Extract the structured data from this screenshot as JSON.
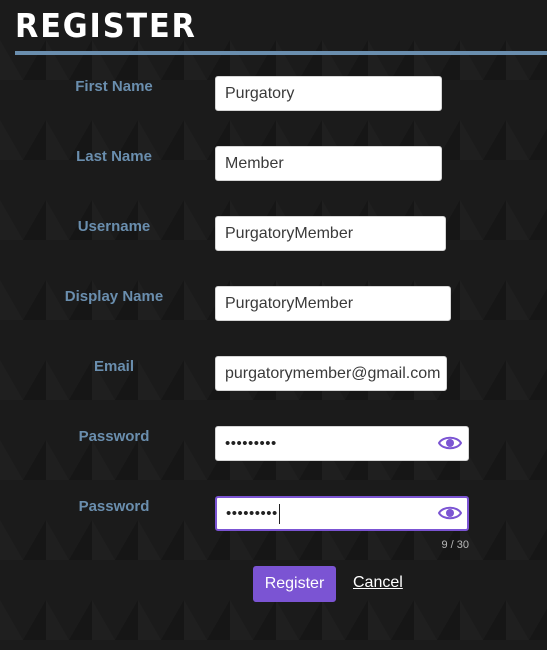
{
  "page": {
    "title": "REGISTER"
  },
  "form": {
    "first_name": {
      "label": "First Name",
      "value": "Purgatory"
    },
    "last_name": {
      "label": "Last Name",
      "value": "Member"
    },
    "username": {
      "label": "Username",
      "value": "PurgatoryMember"
    },
    "display_name": {
      "label": "Display Name",
      "value": "PurgatoryMember"
    },
    "email": {
      "label": "Email",
      "value": "purgatorymember@gmail.com"
    },
    "password": {
      "label": "Password",
      "value": "•••••••••",
      "icon": "eye-icon"
    },
    "password_confirm": {
      "label": "Password",
      "value": "•••••••••",
      "icon": "eye-icon",
      "counter": "9 / 30"
    }
  },
  "actions": {
    "register_label": "Register",
    "cancel_label": "Cancel"
  },
  "colors": {
    "accent": "#7b54d3",
    "label": "#6a8eae",
    "background": "#1b1b1b"
  }
}
